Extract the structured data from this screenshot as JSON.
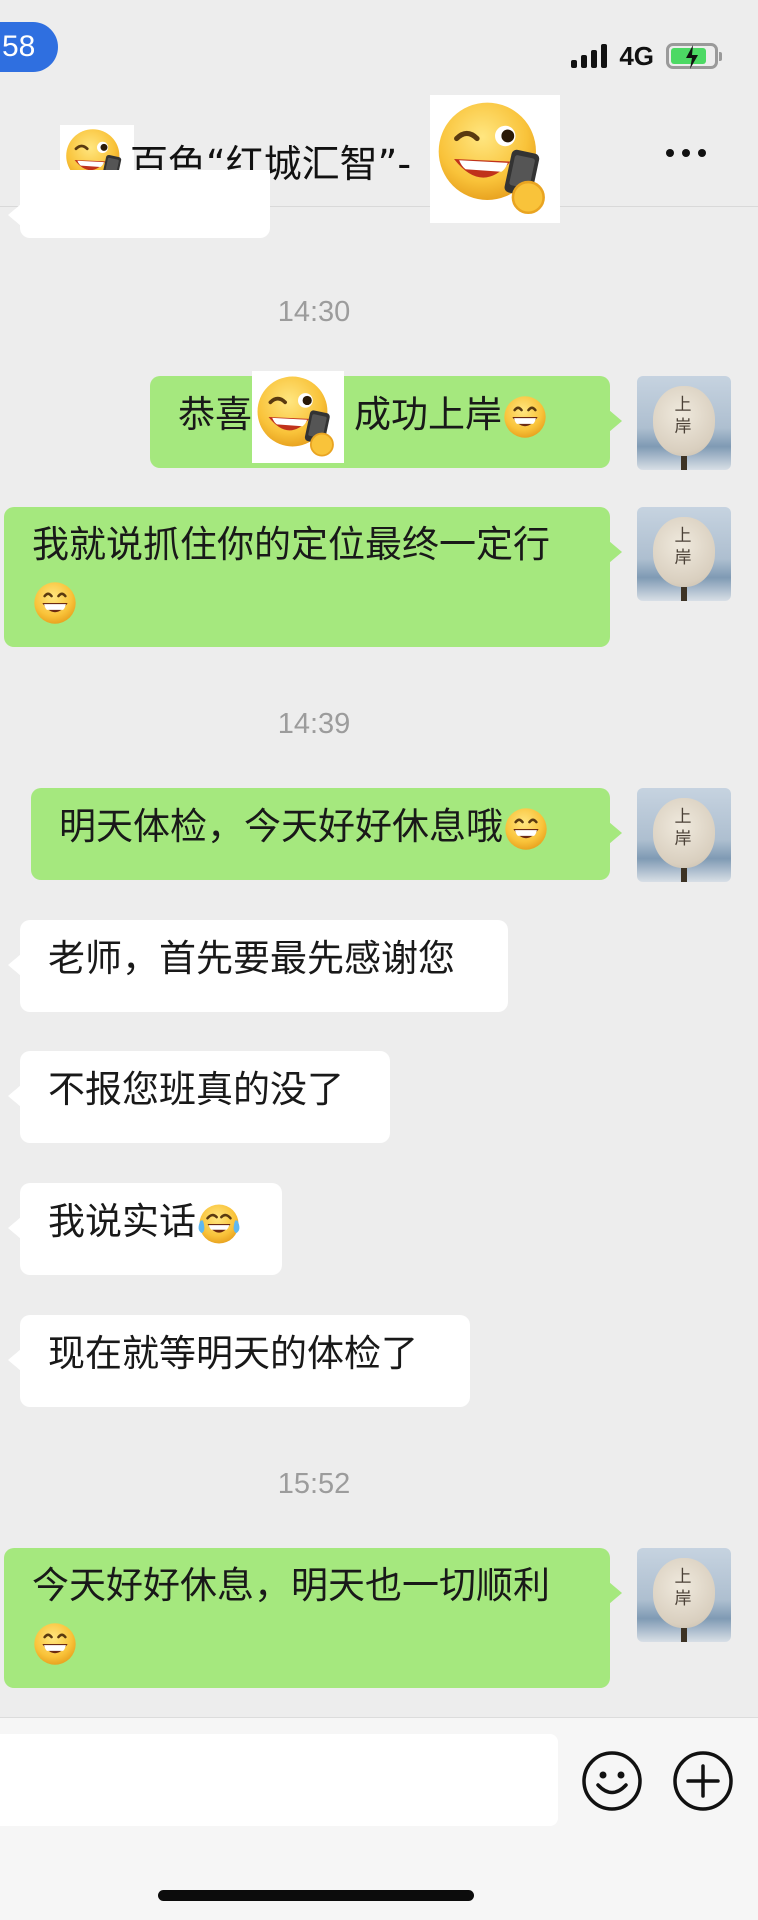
{
  "status_bar": {
    "time": "58",
    "network": "4G",
    "battery_level": 0.75
  },
  "header": {
    "title": "百色“红城汇智”-",
    "more_icon": "more-horizontal-icon"
  },
  "messages": [
    {
      "type": "timestamp",
      "text": "14:30"
    },
    {
      "type": "outgoing",
      "text_before": "恭喜",
      "text_after": "成功上岸",
      "sticker": "wink-phone-emoji",
      "emoji": "grin-emoji"
    },
    {
      "type": "outgoing",
      "text": "我就说抓住你的定位最终一定行",
      "emoji": "grin-emoji"
    },
    {
      "type": "timestamp",
      "text": "14:39"
    },
    {
      "type": "outgoing",
      "text": "明天体检，今天好好休息哦",
      "emoji": "grin-emoji"
    },
    {
      "type": "incoming",
      "text": "老师，首先要最先感谢您"
    },
    {
      "type": "incoming",
      "text": "不报您班真的没了"
    },
    {
      "type": "incoming",
      "text": "我说实话",
      "emoji": "tears-of-joy-emoji"
    },
    {
      "type": "incoming",
      "text": "现在就等明天的体检了"
    },
    {
      "type": "timestamp",
      "text": "15:52"
    },
    {
      "type": "outgoing",
      "text": "今天好好休息，明天也一切顺利",
      "emoji": "grin-emoji"
    }
  ],
  "avatar": {
    "text_line1": "上",
    "text_line2": "岸"
  },
  "input_bar": {
    "emoji_icon": "smiley-icon",
    "add_icon": "plus-circle-icon"
  }
}
